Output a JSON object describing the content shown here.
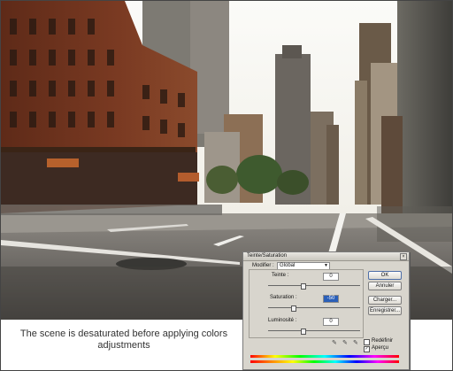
{
  "caption": {
    "line1": "The scene is desaturated before applying  colors",
    "line2": "adjustments"
  },
  "dialog": {
    "title": "Teinte/Saturation",
    "edit_label": "Modifier :",
    "edit_value": "Global",
    "hue_label": "Teinte :",
    "hue_value": "0",
    "saturation_label": "Saturation :",
    "saturation_value": "-50",
    "lightness_label": "Luminosité :",
    "lightness_value": "0",
    "ok_label": "OK",
    "cancel_label": "Annuler",
    "load_label": "Charger...",
    "save_label": "Enregistrer...",
    "colorize_label": "Redéfinir",
    "preview_label": "Aperçu",
    "colorize_checked": false,
    "preview_checked": true
  }
}
